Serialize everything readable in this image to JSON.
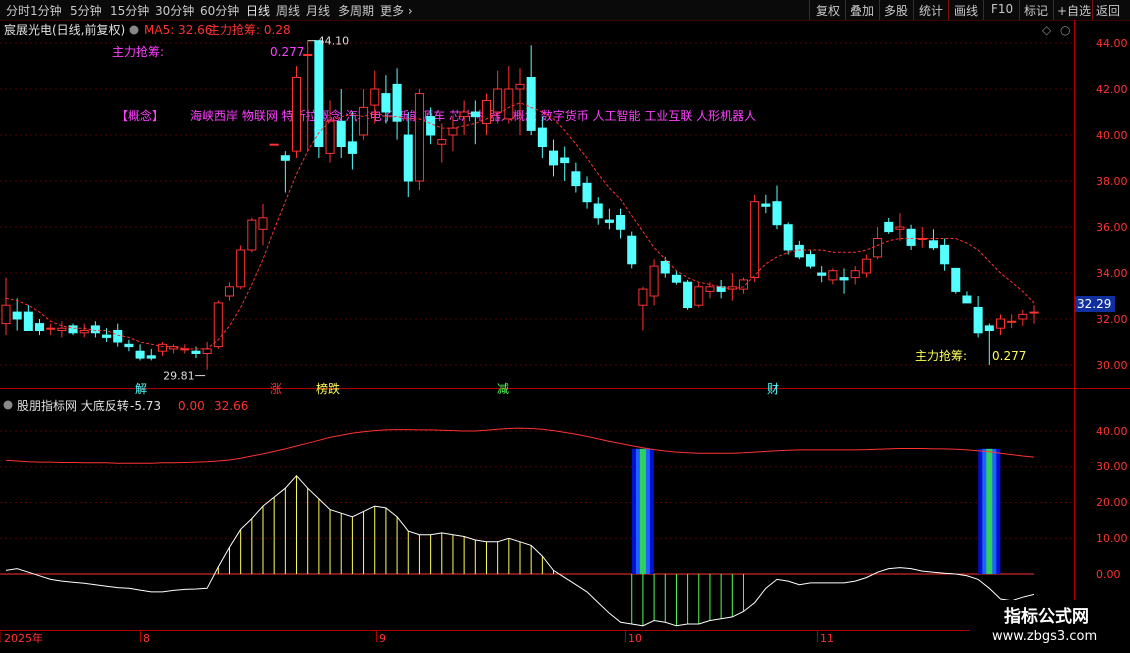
{
  "toolbar": {
    "left_items": [
      "分时",
      "1分钟",
      "5分钟",
      "15分钟",
      "30分钟",
      "60分钟",
      "日线",
      "周线",
      "月线",
      "多周期",
      "更多"
    ],
    "active_item": "日线",
    "right_items": [
      "复权",
      "叠加",
      "多股",
      "统计",
      "画线",
      "F10",
      "标记",
      "+自选",
      "返回"
    ]
  },
  "price_panel": {
    "title": "宸展光电(日线,前复权)",
    "ma_label": "MA5: 32.66",
    "indicator_label": "主力抢筹: 0.28",
    "left_note_label": "主力抢筹:",
    "left_note_value": "0.277",
    "right_note_label": "主力抢筹:",
    "right_note_value": "0.277",
    "high_label": "44.10",
    "low_label": "29.81",
    "concept_label": "【概念】",
    "concept_text": "海峡西岸 物联网 特斯拉概念 汽车电子 新能源车 芯片 机器人概念 数字货币 人工智能 工业互联 人形机器人",
    "current_price": "32.29",
    "event_markers": [
      "解",
      "涨",
      "榜跌",
      "减",
      "财"
    ],
    "y_ticks": [
      "44.00",
      "42.00",
      "40.00",
      "38.00",
      "36.00",
      "34.00",
      "32.00",
      "30.00"
    ]
  },
  "indicator_panel": {
    "title": "股朋指标网 大底反转",
    "value1": "-5.73",
    "value2": "0.00",
    "value3": "32.66",
    "y_ticks": [
      "40.00",
      "30.00",
      "20.00",
      "10.00",
      "0.00"
    ]
  },
  "x_axis": {
    "labels": [
      "2025年",
      "8",
      "9",
      "10",
      "11"
    ]
  },
  "watermark": {
    "title": "指标公式网",
    "url": "www.zbgs3.com"
  },
  "colors": {
    "up": "#ff3232",
    "down": "#54ffff",
    "ma": "#ff3232",
    "concept": "#ff40ff",
    "axis": "#b00000",
    "curve": "#ffffff",
    "fill_pos": "#ffff54",
    "fill_neg": "#54ff54"
  },
  "chart_data": {
    "type": "candlestick",
    "title": "宸展光电(日线,前复权)",
    "ylim": [
      29.5,
      44.5
    ],
    "candles": [
      {
        "o": 31.8,
        "h": 33.8,
        "l": 31.3,
        "c": 32.6
      },
      {
        "o": 32.3,
        "h": 32.9,
        "l": 31.5,
        "c": 32.0
      },
      {
        "o": 32.3,
        "h": 32.6,
        "l": 31.5,
        "c": 31.5
      },
      {
        "o": 31.8,
        "h": 32.0,
        "l": 31.3,
        "c": 31.5
      },
      {
        "o": 31.6,
        "h": 31.8,
        "l": 31.3,
        "c": 31.6
      },
      {
        "o": 31.5,
        "h": 31.9,
        "l": 31.2,
        "c": 31.6
      },
      {
        "o": 31.7,
        "h": 31.8,
        "l": 31.3,
        "c": 31.4
      },
      {
        "o": 31.4,
        "h": 31.8,
        "l": 31.2,
        "c": 31.5
      },
      {
        "o": 31.7,
        "h": 31.9,
        "l": 31.2,
        "c": 31.4
      },
      {
        "o": 31.3,
        "h": 31.6,
        "l": 31.0,
        "c": 31.2
      },
      {
        "o": 31.5,
        "h": 31.8,
        "l": 30.8,
        "c": 31.0
      },
      {
        "o": 30.9,
        "h": 31.1,
        "l": 30.6,
        "c": 30.8
      },
      {
        "o": 30.6,
        "h": 30.9,
        "l": 30.2,
        "c": 30.3
      },
      {
        "o": 30.4,
        "h": 30.7,
        "l": 30.2,
        "c": 30.3
      },
      {
        "o": 30.6,
        "h": 31.0,
        "l": 30.4,
        "c": 30.9
      },
      {
        "o": 30.7,
        "h": 30.9,
        "l": 30.5,
        "c": 30.8
      },
      {
        "o": 30.7,
        "h": 30.9,
        "l": 30.5,
        "c": 30.7
      },
      {
        "o": 30.6,
        "h": 30.8,
        "l": 30.3,
        "c": 30.5
      },
      {
        "o": 30.5,
        "h": 31.0,
        "l": 29.8,
        "c": 30.7
      },
      {
        "o": 30.8,
        "h": 32.8,
        "l": 30.7,
        "c": 32.7
      },
      {
        "o": 33.0,
        "h": 33.6,
        "l": 32.8,
        "c": 33.4
      },
      {
        "o": 33.4,
        "h": 35.2,
        "l": 33.3,
        "c": 35.0
      },
      {
        "o": 35.0,
        "h": 36.4,
        "l": 34.9,
        "c": 36.3
      },
      {
        "o": 35.9,
        "h": 37.0,
        "l": 35.2,
        "c": 36.4
      },
      {
        "o": 39.6,
        "h": 39.6,
        "l": 39.6,
        "c": 39.6
      },
      {
        "o": 39.1,
        "h": 39.3,
        "l": 37.5,
        "c": 38.9
      },
      {
        "o": 39.3,
        "h": 43.0,
        "l": 39.0,
        "c": 42.5
      },
      {
        "o": 43.5,
        "h": 44.1,
        "l": 39.3,
        "c": 43.5
      },
      {
        "o": 44.1,
        "h": 44.1,
        "l": 39.0,
        "c": 39.5
      },
      {
        "o": 39.2,
        "h": 41.5,
        "l": 38.8,
        "c": 40.6
      },
      {
        "o": 40.6,
        "h": 42.0,
        "l": 39.0,
        "c": 39.5
      },
      {
        "o": 39.7,
        "h": 41.0,
        "l": 38.5,
        "c": 39.2
      },
      {
        "o": 40.0,
        "h": 42.0,
        "l": 39.8,
        "c": 41.2
      },
      {
        "o": 41.3,
        "h": 42.8,
        "l": 40.5,
        "c": 42.0
      },
      {
        "o": 41.8,
        "h": 42.6,
        "l": 40.5,
        "c": 41.0
      },
      {
        "o": 42.2,
        "h": 42.9,
        "l": 39.8,
        "c": 40.6
      },
      {
        "o": 40.0,
        "h": 41.0,
        "l": 37.3,
        "c": 38.0
      },
      {
        "o": 38.0,
        "h": 42.0,
        "l": 37.6,
        "c": 41.8
      },
      {
        "o": 40.8,
        "h": 41.2,
        "l": 39.6,
        "c": 40.0
      },
      {
        "o": 39.6,
        "h": 40.5,
        "l": 38.8,
        "c": 39.8
      },
      {
        "o": 40.0,
        "h": 40.8,
        "l": 39.3,
        "c": 40.3
      },
      {
        "o": 40.8,
        "h": 41.5,
        "l": 40.0,
        "c": 41.0
      },
      {
        "o": 41.0,
        "h": 41.5,
        "l": 39.6,
        "c": 40.8
      },
      {
        "o": 40.5,
        "h": 41.8,
        "l": 40.0,
        "c": 41.5
      },
      {
        "o": 41.0,
        "h": 42.8,
        "l": 40.5,
        "c": 42.0
      },
      {
        "o": 40.7,
        "h": 43.0,
        "l": 40.5,
        "c": 42.0
      },
      {
        "o": 42.0,
        "h": 42.9,
        "l": 40.0,
        "c": 42.2
      },
      {
        "o": 42.5,
        "h": 43.9,
        "l": 40.0,
        "c": 40.2
      },
      {
        "o": 40.3,
        "h": 40.8,
        "l": 39.0,
        "c": 39.5
      },
      {
        "o": 39.3,
        "h": 39.8,
        "l": 38.2,
        "c": 38.7
      },
      {
        "o": 39.0,
        "h": 39.5,
        "l": 38.0,
        "c": 38.8
      },
      {
        "o": 38.4,
        "h": 38.8,
        "l": 37.5,
        "c": 37.8
      },
      {
        "o": 37.9,
        "h": 38.2,
        "l": 36.8,
        "c": 37.1
      },
      {
        "o": 37.0,
        "h": 37.3,
        "l": 36.1,
        "c": 36.4
      },
      {
        "o": 36.3,
        "h": 36.8,
        "l": 35.9,
        "c": 36.2
      },
      {
        "o": 36.5,
        "h": 36.8,
        "l": 35.5,
        "c": 35.9
      },
      {
        "o": 35.6,
        "h": 35.8,
        "l": 34.2,
        "c": 34.4
      },
      {
        "o": 32.6,
        "h": 33.4,
        "l": 31.5,
        "c": 33.3
      },
      {
        "o": 33.0,
        "h": 34.6,
        "l": 32.6,
        "c": 34.3
      },
      {
        "o": 34.5,
        "h": 34.7,
        "l": 33.8,
        "c": 34.0
      },
      {
        "o": 33.9,
        "h": 34.1,
        "l": 33.5,
        "c": 33.6
      },
      {
        "o": 33.6,
        "h": 33.7,
        "l": 32.4,
        "c": 32.5
      },
      {
        "o": 32.6,
        "h": 33.6,
        "l": 32.5,
        "c": 33.4
      },
      {
        "o": 33.2,
        "h": 33.6,
        "l": 32.9,
        "c": 33.4
      },
      {
        "o": 33.4,
        "h": 33.7,
        "l": 32.9,
        "c": 33.2
      },
      {
        "o": 33.3,
        "h": 34.0,
        "l": 32.8,
        "c": 33.4
      },
      {
        "o": 33.3,
        "h": 33.8,
        "l": 33.1,
        "c": 33.7
      },
      {
        "o": 33.8,
        "h": 37.4,
        "l": 33.6,
        "c": 37.1
      },
      {
        "o": 37.0,
        "h": 37.4,
        "l": 36.6,
        "c": 36.9
      },
      {
        "o": 37.1,
        "h": 37.8,
        "l": 35.9,
        "c": 36.1
      },
      {
        "o": 36.1,
        "h": 36.2,
        "l": 34.8,
        "c": 35.0
      },
      {
        "o": 35.2,
        "h": 35.4,
        "l": 34.6,
        "c": 34.7
      },
      {
        "o": 34.8,
        "h": 35.0,
        "l": 34.2,
        "c": 34.3
      },
      {
        "o": 34.0,
        "h": 34.3,
        "l": 33.6,
        "c": 33.9
      },
      {
        "o": 33.7,
        "h": 34.2,
        "l": 33.5,
        "c": 34.1
      },
      {
        "o": 33.8,
        "h": 34.2,
        "l": 33.1,
        "c": 33.7
      },
      {
        "o": 33.8,
        "h": 34.3,
        "l": 33.5,
        "c": 34.1
      },
      {
        "o": 34.0,
        "h": 34.8,
        "l": 33.8,
        "c": 34.6
      },
      {
        "o": 34.7,
        "h": 36.0,
        "l": 34.6,
        "c": 35.5
      },
      {
        "o": 36.2,
        "h": 36.4,
        "l": 35.7,
        "c": 35.8
      },
      {
        "o": 35.9,
        "h": 36.6,
        "l": 35.4,
        "c": 36.0
      },
      {
        "o": 35.9,
        "h": 36.1,
        "l": 35.0,
        "c": 35.2
      },
      {
        "o": 35.5,
        "h": 36.0,
        "l": 35.1,
        "c": 35.5
      },
      {
        "o": 35.4,
        "h": 35.9,
        "l": 35.0,
        "c": 35.1
      },
      {
        "o": 35.2,
        "h": 35.5,
        "l": 34.1,
        "c": 34.4
      },
      {
        "o": 34.2,
        "h": 34.2,
        "l": 33.1,
        "c": 33.2
      },
      {
        "o": 33.0,
        "h": 33.2,
        "l": 32.7,
        "c": 32.7
      },
      {
        "o": 32.5,
        "h": 33.0,
        "l": 31.2,
        "c": 31.4
      },
      {
        "o": 31.7,
        "h": 31.8,
        "l": 30.0,
        "c": 31.5
      },
      {
        "o": 31.6,
        "h": 32.2,
        "l": 31.3,
        "c": 32.0
      },
      {
        "o": 31.9,
        "h": 32.2,
        "l": 31.6,
        "c": 31.9
      },
      {
        "o": 32.0,
        "h": 32.4,
        "l": 31.7,
        "c": 32.2
      },
      {
        "o": 32.3,
        "h": 32.6,
        "l": 31.8,
        "c": 32.3
      }
    ],
    "ma": [
      32.9,
      32.8,
      32.6,
      32.3,
      31.9,
      31.7,
      31.6,
      31.6,
      31.5,
      31.5,
      31.3,
      31.2,
      31.0,
      30.9,
      30.8,
      30.8,
      30.7,
      30.7,
      30.7,
      31.1,
      31.7,
      32.5,
      33.5,
      34.6,
      35.9,
      37.1,
      38.3,
      39.3,
      40.1,
      40.6,
      40.8,
      40.9,
      40.8,
      41.0,
      40.8,
      40.8,
      40.7,
      40.7,
      40.5,
      40.3,
      40.3,
      40.4,
      40.5,
      40.7,
      40.9,
      41.2,
      41.4,
      41.2,
      41.0,
      40.7,
      40.2,
      39.6,
      39.0,
      38.3,
      37.7,
      37.2,
      36.5,
      35.8,
      35.1,
      34.6,
      34.1,
      33.8,
      33.6,
      33.5,
      33.4,
      33.3,
      33.4,
      33.9,
      34.4,
      34.7,
      34.9,
      35.0,
      35.0,
      35.0,
      34.9,
      34.9,
      34.9,
      35.0,
      35.2,
      35.4,
      35.5,
      35.5,
      35.5,
      35.5,
      35.5,
      35.5,
      35.3,
      35.0,
      34.5,
      34.0,
      33.6,
      33.2,
      32.7
    ]
  },
  "indicator_data": {
    "type": "line",
    "red_line": [
      31.8,
      31.6,
      31.4,
      31.3,
      31.3,
      31.2,
      31.2,
      31.1,
      31.1,
      31.1,
      31.0,
      31.0,
      31.0,
      31.0,
      31.1,
      31.1,
      31.2,
      31.3,
      31.4,
      31.6,
      31.9,
      32.4,
      33.0,
      33.6,
      34.3,
      35.0,
      35.8,
      36.6,
      37.4,
      38.2,
      38.8,
      39.4,
      39.8,
      40.1,
      40.3,
      40.4,
      40.4,
      40.3,
      40.3,
      40.2,
      40.1,
      40.0,
      40.0,
      40.2,
      40.5,
      40.7,
      40.8,
      40.7,
      40.5,
      40.1,
      39.6,
      39.1,
      38.5,
      37.8,
      37.1,
      36.5,
      35.9,
      35.3,
      34.8,
      34.4,
      34.1,
      33.9,
      33.8,
      33.8,
      33.8,
      33.8,
      33.9,
      34.1,
      34.3,
      34.5,
      34.6,
      34.7,
      34.7,
      34.7,
      34.7,
      34.7,
      34.7,
      34.8,
      34.9,
      35.0,
      35.1,
      35.1,
      35.1,
      35.0,
      35.0,
      34.9,
      34.7,
      34.5,
      34.2,
      33.8,
      33.4,
      33.0,
      32.7
    ],
    "white_line": [
      1.0,
      1.5,
      0.5,
      -0.5,
      -1.5,
      -2.0,
      -2.3,
      -2.6,
      -3.0,
      -3.4,
      -3.8,
      -4.0,
      -4.5,
      -5.0,
      -5.0,
      -4.6,
      -4.3,
      -4.2,
      -4.0,
      2.0,
      7.5,
      12.5,
      15.5,
      19.0,
      21.5,
      24.0,
      27.5,
      24.0,
      21.0,
      18.0,
      17.0,
      16.0,
      17.5,
      19.0,
      18.5,
      16.0,
      12.0,
      11.0,
      11.0,
      11.5,
      11.0,
      10.5,
      9.5,
      9.0,
      9.0,
      10.0,
      9.0,
      8.0,
      5.0,
      1.0,
      -1.0,
      -3.0,
      -5.0,
      -8.0,
      -11.0,
      -13.5,
      -14.0,
      -14.5,
      -13.0,
      -13.5,
      -14.5,
      -14.0,
      -14.0,
      -13.0,
      -12.5,
      -12.0,
      -10.5,
      -8.0,
      -4.0,
      -1.5,
      -2.0,
      -3.0,
      -2.5,
      -2.5,
      -2.5,
      -2.5,
      -2.0,
      -1.0,
      0.5,
      1.5,
      1.8,
      1.5,
      0.8,
      0.5,
      0.2,
      0.0,
      -0.5,
      -1.5,
      -4.0,
      -7.0,
      -7.5,
      -6.5,
      -5.7
    ],
    "signal_bars": [
      57,
      88
    ]
  }
}
